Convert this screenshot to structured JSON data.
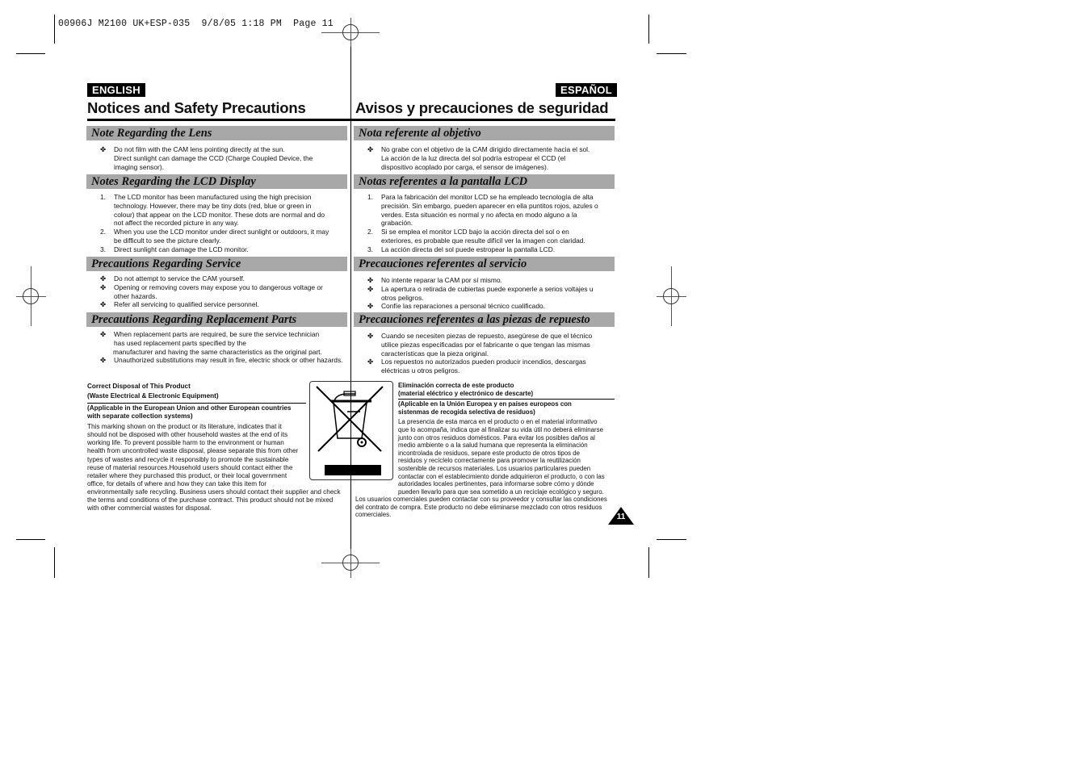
{
  "slug": "00906J M2100 UK+ESP-035  9/8/05 1:18 PM  Page 11",
  "english": {
    "lang_label": "ENGLISH",
    "title": "Notices and Safety Precautions",
    "sections": [
      {
        "heading": "Note Regarding the Lens",
        "bullet": "✤",
        "items": [
          "Do not film with the CAM lens pointing directly at the sun.",
          "Direct sunlight can damage the CCD (Charge Coupled Device, the",
          "imaging sensor)."
        ]
      },
      {
        "heading": "Notes Regarding the LCD Display",
        "items": [
          {
            "n": "1.",
            "lines": [
              "The LCD monitor has been manufactured using the high precision",
              "technology. However, there may be tiny dots (red, blue or green in",
              "colour) that appear on the LCD monitor. These dots are normal and do",
              "not affect the recorded picture in any way."
            ]
          },
          {
            "n": "2.",
            "lines": [
              "When you use the LCD monitor under direct sunlight or outdoors, it may",
              "be difficult to see the picture clearly."
            ]
          },
          {
            "n": "3.",
            "lines": [
              "Direct sunlight can damage the LCD monitor."
            ]
          }
        ]
      },
      {
        "heading": "Precautions Regarding Service",
        "items": [
          [
            "Do not attempt to service the CAM yourself."
          ],
          [
            "Opening or removing covers may expose you to dangerous voltage or",
            "other hazards."
          ],
          [
            "Refer all servicing to qualified service personnel."
          ]
        ]
      },
      {
        "heading": "Precautions Regarding Replacement Parts",
        "items": [
          [
            "When replacement parts are required, be sure the service technician",
            "has used replacement parts specified by the"
          ],
          [
            "Unauthorized substitutions may result in fire, electric shock or other hazards."
          ]
        ],
        "continuation": "manufacturer and having the same characteristics as the original part."
      }
    ],
    "disposal": {
      "title1": "Correct Disposal of This Product",
      "title2": "(Waste Electrical & Electronic Equipment)",
      "sub1": "(Applicable in the European Union and other European countries",
      "sub2": "with separate collection systems)",
      "lines": [
        "This marking shown on the product or its literature, indicates that it",
        "should not be disposed with other household wastes at the end of its",
        "working life.  To prevent possible harm to the environment or human",
        "health from uncontrolled waste disposal, please separate this from other",
        "types of wastes and recycle it responsibly to promote the sustainable",
        "reuse of material resources.Household users should contact either the",
        "retailer where they purchased this product, or their local government",
        "office, for details of where and how they can take this item for",
        "environmentally safe recycling.  Business users should contact their supplier and check",
        "the terms and conditions of the purchase contract. This product should not be mixed",
        "with other commercial wastes for disposal."
      ]
    }
  },
  "spanish": {
    "lang_label": "ESPAÑOL",
    "title": "Avisos y precauciones de seguridad",
    "sections": [
      {
        "heading": "Nota referente al objetivo",
        "items": [
          "No grabe con el objetivo de la CAM dirigido directamente hacia el sol.",
          "La acción de la luz directa del sol podría estropear el CCD (el",
          "dispositivo acoplado por carga, el sensor de imágenes)."
        ]
      },
      {
        "heading": "Notas referentes a la pantalla LCD",
        "items": [
          {
            "n": "1.",
            "lines": [
              "Para la fabricación del monitor LCD se ha empleado tecnología de alta",
              "precisión. Sin embargo, pueden aparecer en ella puntitos rojos, azules o",
              "verdes. Esta situación es normal y no afecta en modo alguno a la",
              "grabación."
            ]
          },
          {
            "n": "2.",
            "lines": [
              "Si se emplea el monitor LCD bajo la acción directa del sol o en",
              "exteriores, es probable que resulte difícil ver la imagen con claridad."
            ]
          },
          {
            "n": "3.",
            "lines": [
              "La acción directa del sol puede estropear la pantalla LCD."
            ]
          }
        ]
      },
      {
        "heading": "Precauciones referentes al servicio",
        "items": [
          [
            "No intente reparar la CAM por sí mismo."
          ],
          [
            "La apertura o retirada de cubiertas puede exponerle a serios voltajes u",
            "otros peligros."
          ],
          [
            "Confíe las reparaciones a personal técnico cualificado."
          ]
        ]
      },
      {
        "heading": "Precauciones referentes a las piezas de repuesto",
        "items": [
          [
            "Cuando se necesiten piezas de repuesto, asegúrese de que el técnico",
            "utilice piezas especificadas por el fabricante o que tengan las mismas",
            "características que la pieza original."
          ],
          [
            "Los repuestos no autorizados pueden producir incendios, descargas",
            "eléctricas u otros peligros."
          ]
        ]
      }
    ],
    "disposal": {
      "title1": "Eliminación correcta de este producto",
      "title2": "(material eléctrico y electrónico de descarte)",
      "sub1": "(Aplicable en la Unión Europea y en países europeos con",
      "sub2": "sistenmas de recogida selectiva de residuos)",
      "lines": [
        "La presencia de esta marca en el producto o en el material informativo",
        "que lo acompaña, indica que al finalizar su vida útil no deberá eliminarse",
        "junto con otros residuos domésticos. Para evitar los posibles daños al",
        "medio ambiente o a la salud humana que representa la eliminación",
        "incontrolada de residuos, separe este producto de otros tipos de",
        "residuos y recíclelo correctamente para promover la reutilización",
        "sostenible de recursos materiales. Los usuarios particulares pueden",
        "contactar con el establecimiento donde adquirieron el producto, o con las",
        "autoridades locales pertinentes, para informarse sobre cómo y dónde",
        "pueden llevarlo para que sea sometido a un reciclaje ecológico y seguro."
      ],
      "tail": [
        "Los usuarios comerciales pueden contactar con su proveedor y consultar las condiciones",
        "del contrato de compra. Este producto no debe eliminarse mezclado con otros residuos",
        "comerciales."
      ]
    }
  },
  "weee_icon": "crossed-out-wheelie-bin-icon",
  "page_number": "11"
}
